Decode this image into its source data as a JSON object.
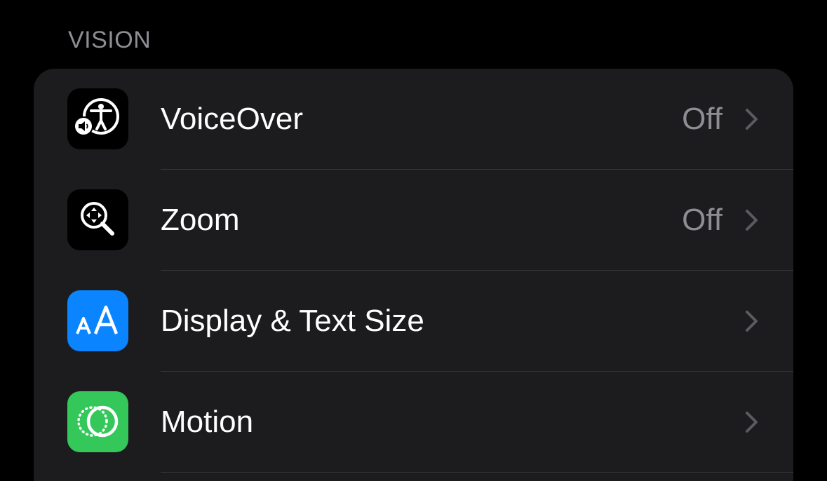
{
  "section": {
    "header": "VISION"
  },
  "rows": [
    {
      "label": "VoiceOver",
      "value": "Off",
      "icon": "voiceover-icon",
      "icon_bg": "#000000"
    },
    {
      "label": "Zoom",
      "value": "Off",
      "icon": "zoom-icon",
      "icon_bg": "#000000"
    },
    {
      "label": "Display & Text Size",
      "value": "",
      "icon": "text-size-icon",
      "icon_bg": "#0a84ff"
    },
    {
      "label": "Motion",
      "value": "",
      "icon": "motion-icon",
      "icon_bg": "#34c759"
    }
  ],
  "colors": {
    "background": "#000000",
    "group_background": "#1c1c1e",
    "secondary_text": "#8d8d93",
    "chevron": "#5a5a5f",
    "separator": "#38383a"
  }
}
